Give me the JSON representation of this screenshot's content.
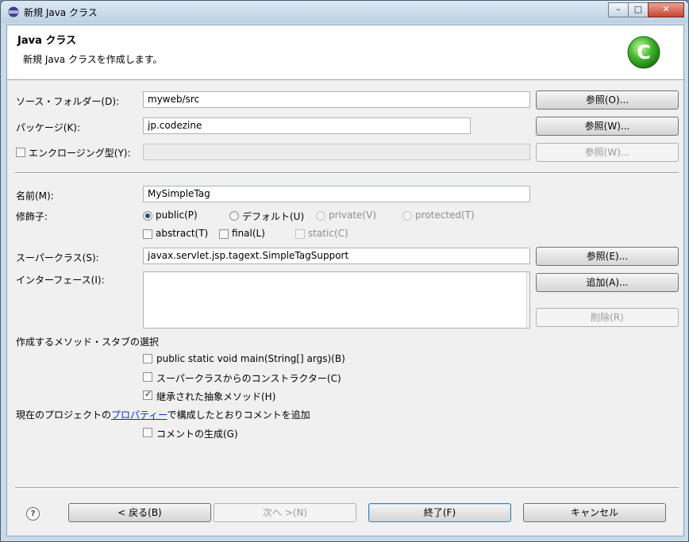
{
  "window": {
    "title": "新規 Java クラス",
    "controls": [
      "–",
      "□",
      "✕"
    ]
  },
  "banner": {
    "title": "Java クラス",
    "description": "新規 Java クラスを作成します。",
    "icon": "java-class-wizard-icon",
    "icon_letter": "C"
  },
  "source_folder": {
    "label": "ソース・フォルダー(D):",
    "value": "myweb/src",
    "browse": "参照(O)..."
  },
  "package": {
    "label": "パッケージ(K):",
    "value": "jp.codezine",
    "browse": "参照(W)..."
  },
  "enclosing": {
    "label": "エンクロージング型(Y):",
    "value": "",
    "browse": "参照(W)...",
    "checked": false
  },
  "name": {
    "label": "名前(M):",
    "value": "MySimpleTag"
  },
  "modifiers": {
    "label": "修飾子:",
    "radios": [
      {
        "label": "public(P)",
        "checked": true,
        "enabled": true
      },
      {
        "label": "デフォルト(U)",
        "checked": false,
        "enabled": true
      },
      {
        "label": "private(V)",
        "checked": false,
        "enabled": false
      },
      {
        "label": "protected(T)",
        "checked": false,
        "enabled": false
      }
    ],
    "checks": [
      {
        "label": "abstract(T)",
        "checked": false,
        "enabled": true
      },
      {
        "label": "final(L)",
        "checked": false,
        "enabled": true
      },
      {
        "label": "static(C)",
        "checked": false,
        "enabled": false
      }
    ]
  },
  "superclass": {
    "label": "スーパークラス(S):",
    "value": "javax.servlet.jsp.tagext.SimpleTagSupport",
    "browse": "参照(E)..."
  },
  "interfaces": {
    "label": "インターフェース(I):",
    "items": [],
    "add": "追加(A)...",
    "remove": "削除(R)"
  },
  "stubs": {
    "label": "作成するメソッド・スタブの選択",
    "options": [
      {
        "label": "public static void main(String[] args)(B)",
        "checked": false
      },
      {
        "label": "スーパークラスからのコンストラクター(C)",
        "checked": false
      },
      {
        "label": "継承された抽象メソッド(H)",
        "checked": true
      }
    ]
  },
  "comments": {
    "prefix": "現在のプロジェクトの",
    "link": "プロパティー",
    "suffix": "で構成したとおりコメントを追加",
    "option": {
      "label": "コメントの生成(G)",
      "checked": false
    }
  },
  "footer": {
    "help": "?",
    "back": "< 戻る(B)",
    "next": "次へ >(N)",
    "finish": "終了(F)",
    "cancel": "キャンセル"
  }
}
